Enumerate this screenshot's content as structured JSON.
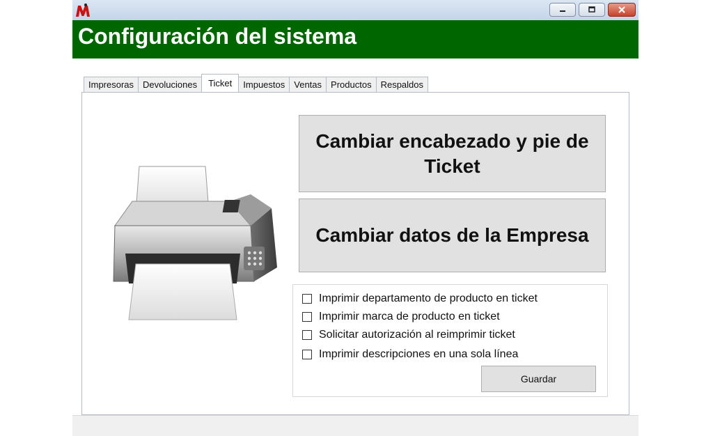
{
  "window": {
    "title": "",
    "icon": "app-m-logo-icon",
    "controls": [
      "minimize-icon",
      "maximize-icon",
      "close-icon"
    ]
  },
  "header": {
    "title": "Configuración del sistema",
    "background": "#006600"
  },
  "tabs": [
    {
      "label": "Impresoras",
      "active": false
    },
    {
      "label": "Devoluciones",
      "active": false
    },
    {
      "label": "Ticket",
      "active": true
    },
    {
      "label": "Impuestos",
      "active": false
    },
    {
      "label": "Ventas",
      "active": false
    },
    {
      "label": "Productos",
      "active": false
    },
    {
      "label": "Respaldos",
      "active": false
    }
  ],
  "ticket": {
    "illustration": "printer-icon",
    "buttons": {
      "header_footer": "Cambiar encabezado y pie de Ticket",
      "company": "Cambiar datos de la Empresa"
    },
    "options": [
      {
        "label": "Imprimir departamento de producto en ticket",
        "checked": false
      },
      {
        "label": "Imprimir marca de producto en ticket",
        "checked": false
      },
      {
        "label": "Solicitar autorización al reimprimir ticket",
        "checked": false
      },
      {
        "label": "Imprimir descripciones en una sola línea",
        "checked": false
      }
    ],
    "save_label": "Guardar"
  }
}
